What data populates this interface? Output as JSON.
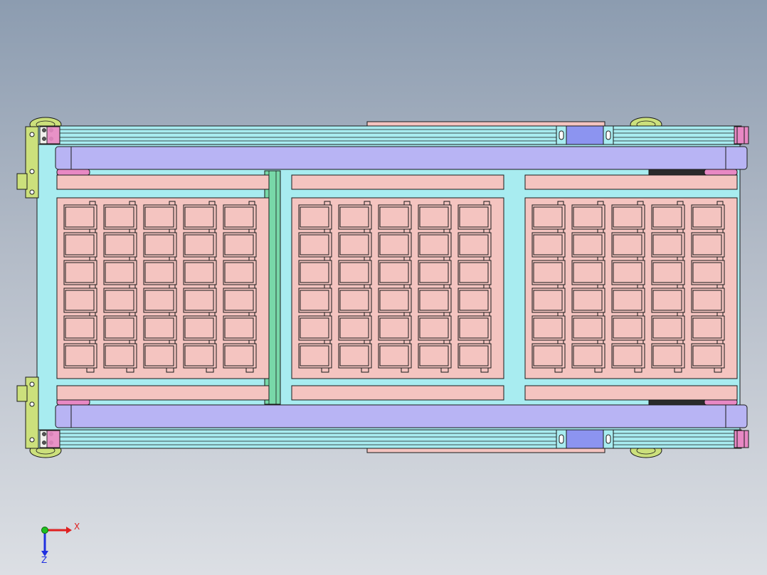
{
  "view": {
    "background_top": "#8c9cb0",
    "background_bottom": "#dcdfe4"
  },
  "colors": {
    "frame_cyan": "#a8ecf0",
    "frame_dark": "#1a1a1a",
    "beam_purple": "#b8b4f4",
    "bracket_blue": "#8c94f0",
    "tray_pink": "#f4c4c0",
    "end_cap_pink": "#e888c4",
    "roller_green": "#78d8a8",
    "side_olive": "#cce07c",
    "axis_x": "#e02020",
    "axis_y": "#20c020",
    "axis_z": "#2030e0"
  },
  "model": {
    "trays": 3,
    "pocket_rows": 6,
    "pocket_cols": 5
  },
  "triad": {
    "x_label": "X",
    "z_label": "Z"
  }
}
